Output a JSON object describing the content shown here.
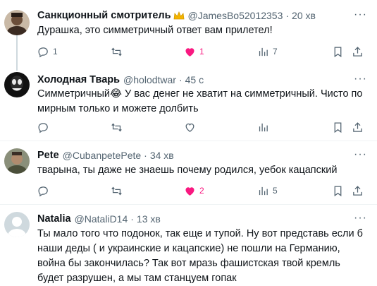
{
  "tweets": [
    {
      "name": "Санкционный смотритель",
      "handle": "@JamesBo52012353",
      "time": "20 хв",
      "text": "Дурашка, это симметричный ответ вам прилетел!",
      "replies": "1",
      "retweets": "",
      "likes": "1",
      "views": "7",
      "liked": true
    },
    {
      "name": "Холодная Тварь",
      "handle": "@holodtwar",
      "time": "45 с",
      "text": "Симметричный😂 У вас денег не хватит на симметричный. Чисто по мирным только и можете долбить",
      "replies": "",
      "retweets": "",
      "likes": "",
      "views": "",
      "liked": false
    },
    {
      "name": "Pete",
      "handle": "@CubanpetePete",
      "time": "34 хв",
      "text": "тварына, ты даже не знаешь почему родился, уебок кацапский",
      "replies": "",
      "retweets": "",
      "likes": "2",
      "views": "5",
      "liked": true
    },
    {
      "name": "Natalia",
      "handle": "@NataliD14",
      "time": "13 хв",
      "text": "Ты мало того что подонок, так еще и тупой. Ну вот представь если б наши деды ( и украинские и кацапские) не пошли на Германию, война бы закончилась? Так вот мразь фашистская твой кремль будет разрушен, а мы там станцуем гопак",
      "replies": "",
      "retweets": "",
      "likes": "",
      "views": "",
      "liked": false
    }
  ],
  "separator": "·",
  "more_glyph": "···",
  "colors": {
    "like": "#f91880",
    "muted": "#536471",
    "crown": "#f4b400"
  }
}
